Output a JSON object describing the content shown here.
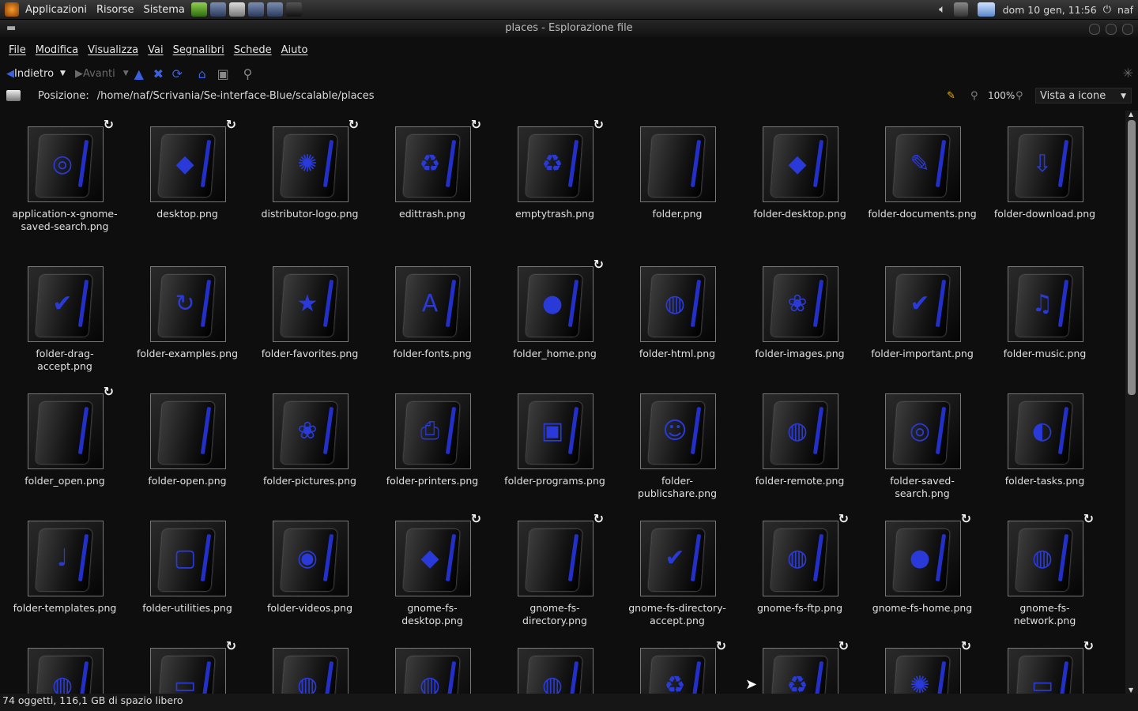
{
  "panel": {
    "menus": [
      "Applicazioni",
      "Risorse",
      "Sistema"
    ],
    "clock": "dom 10 gen, 11:56",
    "user": "naf"
  },
  "window": {
    "title": "places - Esplorazione file"
  },
  "menubar": [
    "File",
    "Modifica",
    "Visualizza",
    "Vai",
    "Segnalibri",
    "Schede",
    "Aiuto"
  ],
  "toolbar": {
    "back": "Indietro",
    "forward": "Avanti"
  },
  "location": {
    "label": "Posizione:",
    "path": "/home/naf/Scrivania/Se-interface-Blue/scalable/places",
    "zoom": "100%",
    "view": "Vista a icone"
  },
  "items": [
    {
      "label": "application-x-gnome-saved-search.png",
      "glyph": "◎",
      "link": true
    },
    {
      "label": "desktop.png",
      "glyph": "◆",
      "link": true
    },
    {
      "label": "distributor-logo.png",
      "glyph": "✺",
      "link": true
    },
    {
      "label": "edittrash.png",
      "glyph": "♻",
      "link": true
    },
    {
      "label": "emptytrash.png",
      "glyph": "♻",
      "link": true
    },
    {
      "label": "folder.png",
      "glyph": "",
      "link": false
    },
    {
      "label": "folder-desktop.png",
      "glyph": "◆",
      "link": false
    },
    {
      "label": "folder-documents.png",
      "glyph": "✎",
      "link": false
    },
    {
      "label": "folder-download.png",
      "glyph": "⇩",
      "link": false
    },
    {
      "label": "folder-drag-accept.png",
      "glyph": "✔",
      "link": false
    },
    {
      "label": "folder-examples.png",
      "glyph": "↻",
      "link": false
    },
    {
      "label": "folder-favorites.png",
      "glyph": "★",
      "link": false
    },
    {
      "label": "folder-fonts.png",
      "glyph": "A",
      "link": false
    },
    {
      "label": "folder_home.png",
      "glyph": "●",
      "link": true
    },
    {
      "label": "folder-html.png",
      "glyph": "◍",
      "link": false
    },
    {
      "label": "folder-images.png",
      "glyph": "❀",
      "link": false
    },
    {
      "label": "folder-important.png",
      "glyph": "✔",
      "link": false
    },
    {
      "label": "folder-music.png",
      "glyph": "♫",
      "link": false
    },
    {
      "label": "folder_open.png",
      "glyph": "",
      "link": true
    },
    {
      "label": "folder-open.png",
      "glyph": "",
      "link": false
    },
    {
      "label": "folder-pictures.png",
      "glyph": "❀",
      "link": false
    },
    {
      "label": "folder-printers.png",
      "glyph": "⎙",
      "link": false
    },
    {
      "label": "folder-programs.png",
      "glyph": "▣",
      "link": false
    },
    {
      "label": "folder-publicshare.png",
      "glyph": "☺",
      "link": false
    },
    {
      "label": "folder-remote.png",
      "glyph": "◍",
      "link": false
    },
    {
      "label": "folder-saved-search.png",
      "glyph": "◎",
      "link": false
    },
    {
      "label": "folder-tasks.png",
      "glyph": "◐",
      "link": false
    },
    {
      "label": "folder-templates.png",
      "glyph": "♩",
      "link": false
    },
    {
      "label": "folder-utilities.png",
      "glyph": "▢",
      "link": false
    },
    {
      "label": "folder-videos.png",
      "glyph": "◉",
      "link": false
    },
    {
      "label": "gnome-fs-desktop.png",
      "glyph": "◆",
      "link": true
    },
    {
      "label": "gnome-fs-directory.png",
      "glyph": "",
      "link": true
    },
    {
      "label": "gnome-fs-directory-accept.png",
      "glyph": "✔",
      "link": false
    },
    {
      "label": "gnome-fs-ftp.png",
      "glyph": "◍",
      "link": true
    },
    {
      "label": "gnome-fs-home.png",
      "glyph": "●",
      "link": true
    },
    {
      "label": "gnome-fs-network.png",
      "glyph": "◍",
      "link": true
    },
    {
      "label": "",
      "glyph": "◍",
      "link": false
    },
    {
      "label": "",
      "glyph": "▭",
      "link": true
    },
    {
      "label": "",
      "glyph": "◍",
      "link": false
    },
    {
      "label": "",
      "glyph": "◍",
      "link": false
    },
    {
      "label": "",
      "glyph": "◍",
      "link": false
    },
    {
      "label": "",
      "glyph": "♻",
      "link": true
    },
    {
      "label": "",
      "glyph": "♻",
      "link": true
    },
    {
      "label": "",
      "glyph": "✺",
      "link": true
    },
    {
      "label": "",
      "glyph": "▭",
      "link": true
    }
  ],
  "status": "74 oggetti, 116,1 GB di spazio libero",
  "colors": {
    "accent": "#2330c8",
    "background": "#0e0e0e"
  }
}
